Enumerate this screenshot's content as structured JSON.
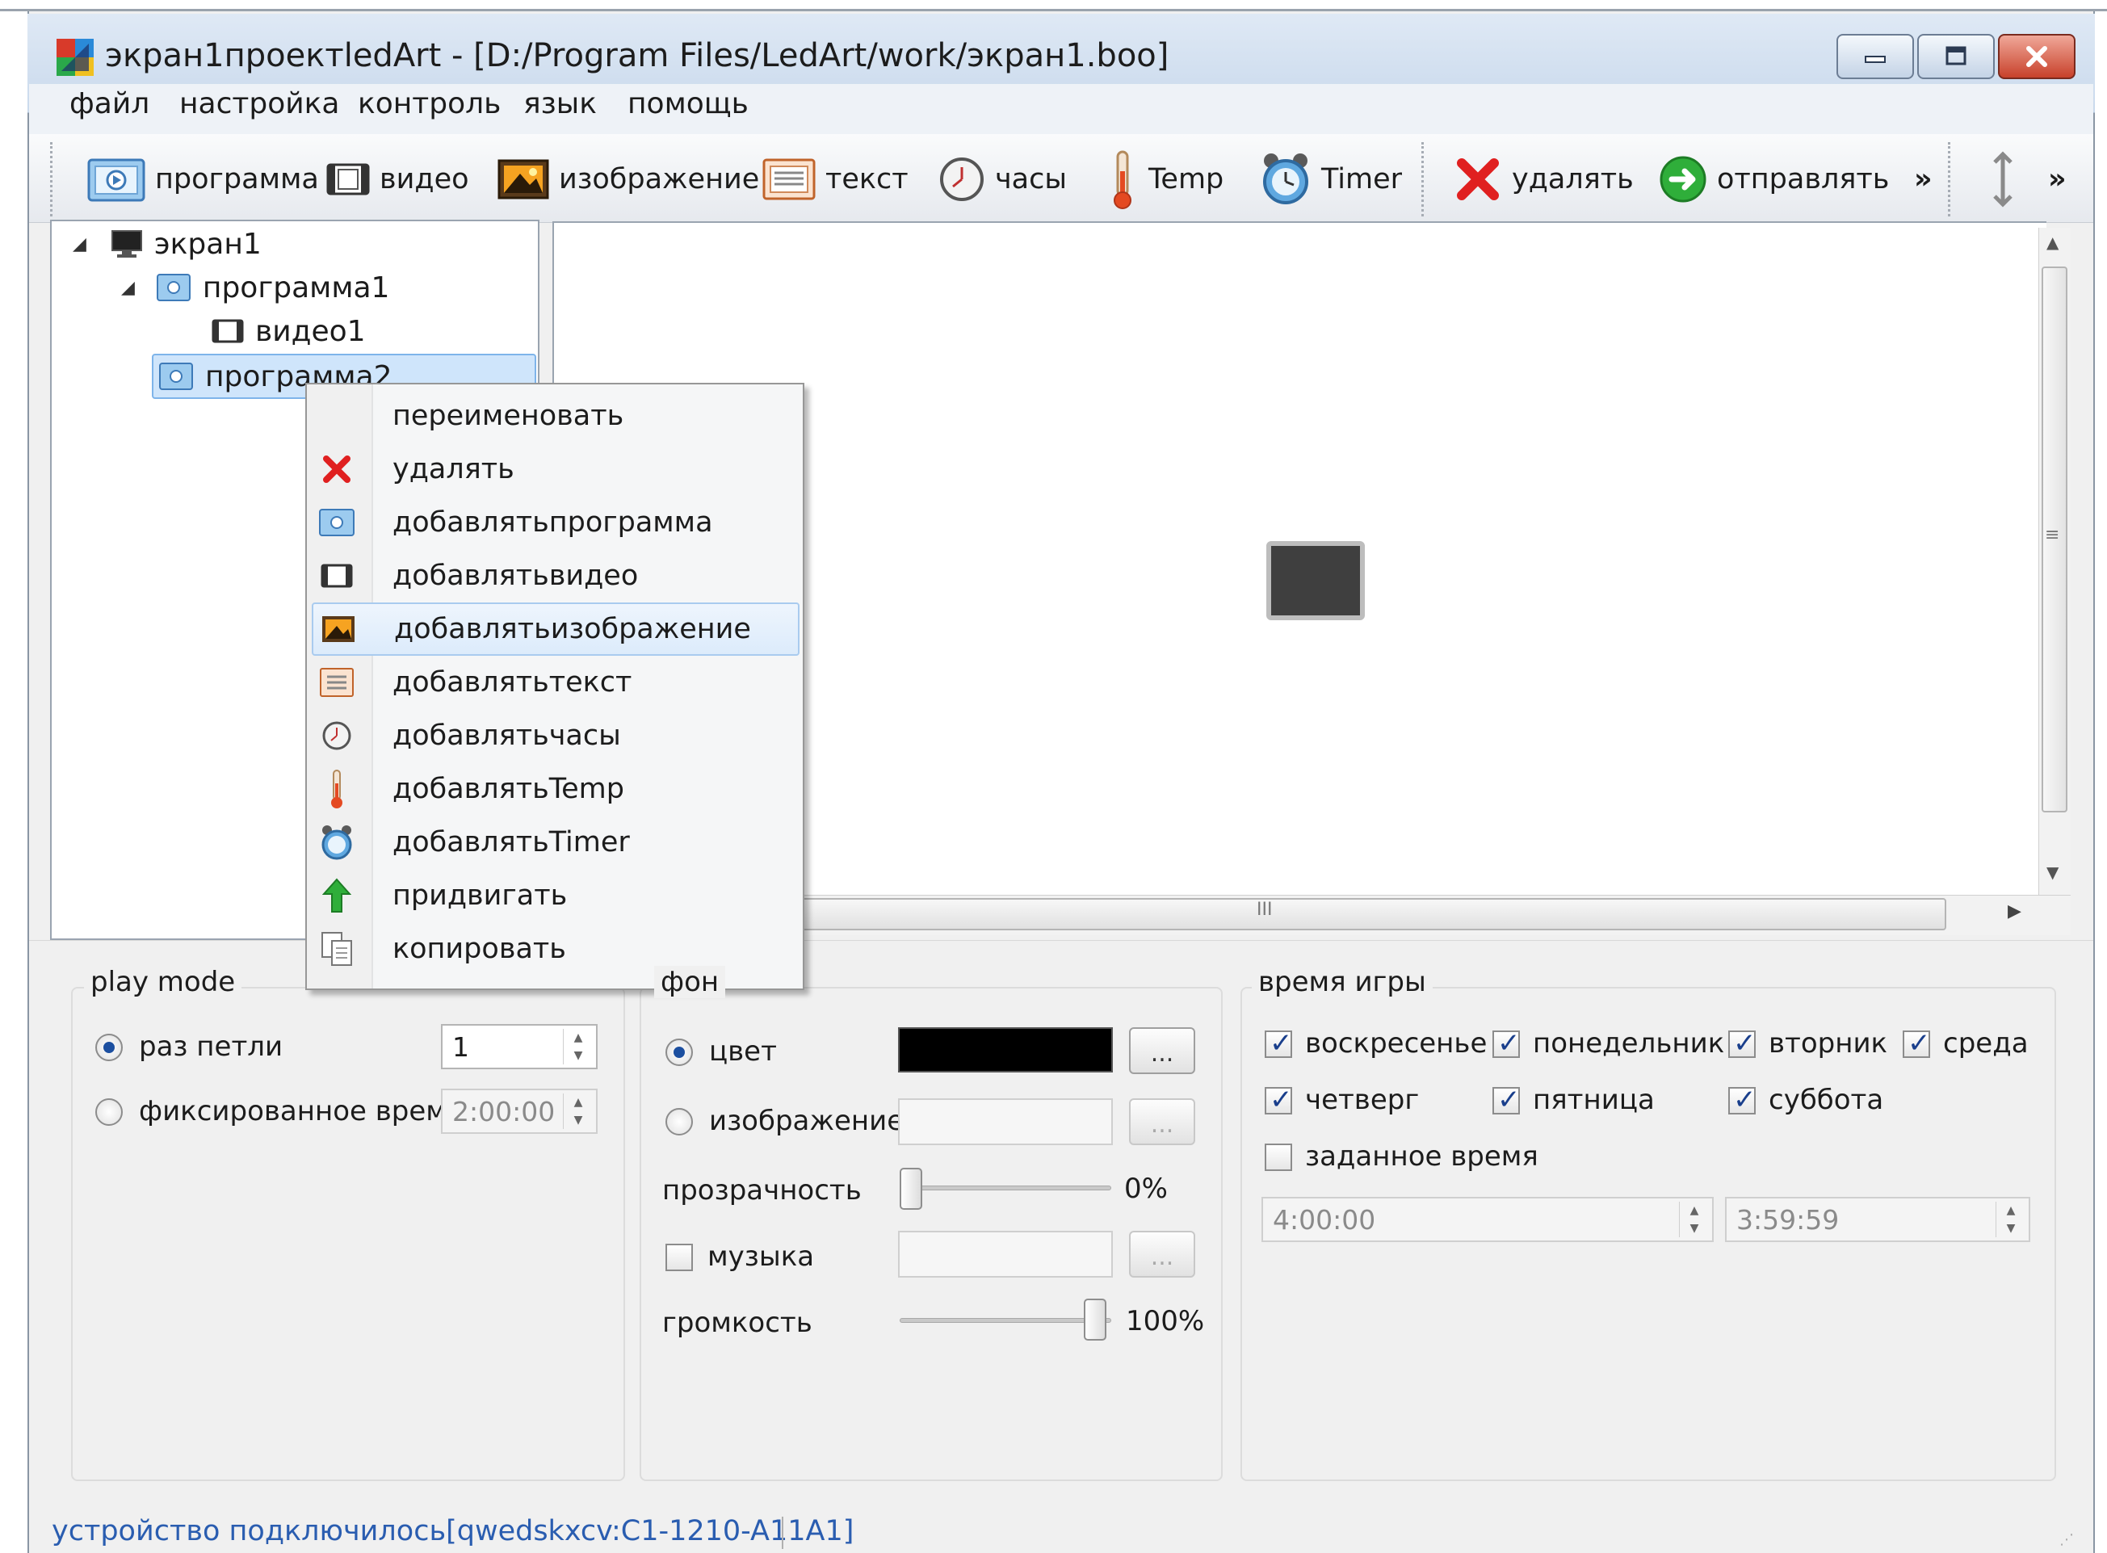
{
  "window": {
    "title": "экран1проектledArt - [D:/Program Files/LedArt/work/экран1.boo]",
    "controls": [
      "minimize",
      "maximize",
      "close"
    ]
  },
  "menubar": [
    "файл",
    "настройка",
    "контроль",
    "язык",
    "помощь"
  ],
  "toolbar": {
    "items": [
      {
        "label": "программа",
        "icon": "program-icon"
      },
      {
        "label": "видео",
        "icon": "video-icon"
      },
      {
        "label": "изображение",
        "icon": "image-icon"
      },
      {
        "label": "текст",
        "icon": "text-icon"
      },
      {
        "label": "часы",
        "icon": "clock-icon"
      },
      {
        "label": "Temp",
        "icon": "thermometer-icon"
      },
      {
        "label": "Timer",
        "icon": "alarm-clock-icon"
      },
      {
        "label": "удалять",
        "icon": "delete-icon"
      },
      {
        "label": "отправлять",
        "icon": "send-icon"
      }
    ],
    "overflow": "»"
  },
  "tree": {
    "nodes": [
      {
        "label": "экран1",
        "icon": "monitor-icon",
        "level": 0,
        "expanded": true
      },
      {
        "label": "программа1",
        "icon": "program-icon",
        "level": 1,
        "expanded": true
      },
      {
        "label": "видео1",
        "icon": "video-icon",
        "level": 2
      },
      {
        "label": "программа2",
        "icon": "program-icon",
        "level": 1,
        "selected": true
      }
    ]
  },
  "context_menu": {
    "items": [
      {
        "label": "переименовать",
        "icon": ""
      },
      {
        "label": "удалять",
        "icon": "delete-icon"
      },
      {
        "label": "добавлятьпрограмма",
        "icon": "program-icon"
      },
      {
        "label": "добавлятьвидео",
        "icon": "video-icon"
      },
      {
        "label": "добавлятьизображение",
        "icon": "image-icon",
        "highlighted": true
      },
      {
        "label": "добавлятьтекст",
        "icon": "text-icon"
      },
      {
        "label": "добавлятьчасы",
        "icon": "clock-icon"
      },
      {
        "label": "добавлятьTemp",
        "icon": "thermometer-icon"
      },
      {
        "label": "добавлятьTimer",
        "icon": "alarm-clock-icon"
      },
      {
        "label": "придвигать",
        "icon": "up-arrow-icon"
      },
      {
        "label": "копировать",
        "icon": "copy-icon"
      }
    ]
  },
  "canvas": {
    "scroll_grip": "III"
  },
  "play_mode": {
    "title": "play mode",
    "loop_label": "раз петли",
    "loop_value": "1",
    "loop_selected": true,
    "fixed_label": "фиксированное время",
    "fixed_value": "2:00:00"
  },
  "background": {
    "title": "фон",
    "color_label": "цвет",
    "color_selected": true,
    "color_value": "#000000",
    "image_label": "изображение",
    "opacity_label": "прозрачность",
    "opacity_value": "0%",
    "opacity_fraction": 0.0,
    "music_label": "музыка",
    "music_checked": false,
    "volume_label": "громкость",
    "volume_value": "100%",
    "volume_fraction": 1.0,
    "browse_label": "..."
  },
  "play_time": {
    "title": "время игры",
    "days": [
      {
        "label": "воскресенье",
        "checked": true
      },
      {
        "label": "понедельник",
        "checked": true
      },
      {
        "label": "вторник",
        "checked": true
      },
      {
        "label": "среда",
        "checked": true
      },
      {
        "label": "четверг",
        "checked": true
      },
      {
        "label": "пятница",
        "checked": true
      },
      {
        "label": "суббота",
        "checked": true
      }
    ],
    "scheduled_label": "заданное время",
    "scheduled_checked": false,
    "start": "4:00:00",
    "end": "3:59:59"
  },
  "status": "устройство подключилось[qwedskxcv:C1-1210-A11A1]",
  "colors": {
    "accent": "#2a5db0",
    "selection": "#cfe5fb",
    "close_button": "#c8412b"
  }
}
